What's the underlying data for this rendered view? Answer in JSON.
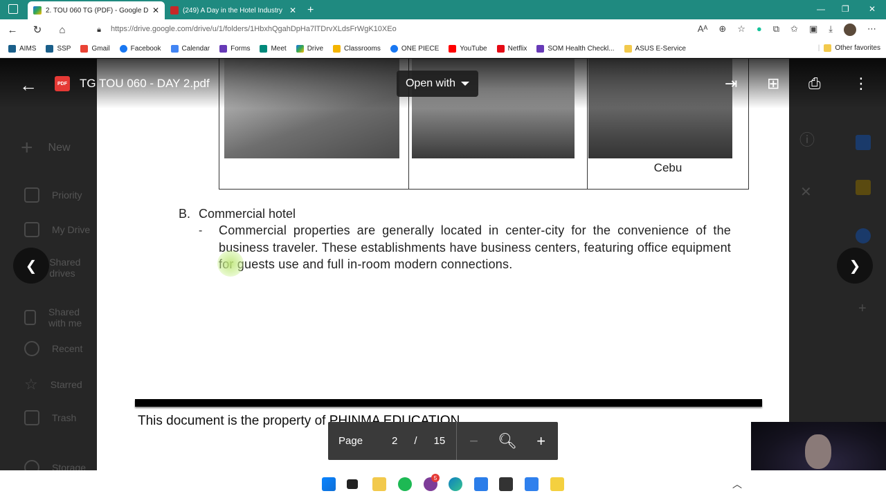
{
  "browser": {
    "tabs": [
      {
        "title": "2. TOU 060 TG (PDF) - Google Dr",
        "active": true
      },
      {
        "title": "(249) A Day in the Hotel Industry",
        "active": false
      }
    ],
    "url": "https://drive.google.com/drive/u/1/folders/1HbxhQgahDpHa7lTDrvXLdsFrWgK10XEo",
    "bookmarks": [
      "AIMS",
      "SSP",
      "Gmail",
      "Facebook",
      "Calendar",
      "Forms",
      "Meet",
      "Drive",
      "Classrooms",
      "ONE PIECE",
      "YouTube",
      "Netflix",
      "SOM Health Checkl...",
      "ASUS E-Service"
    ],
    "other_favorites": "Other favorites"
  },
  "drive": {
    "new_label": "New",
    "sidebar": [
      "Priority",
      "My Drive",
      "Shared drives",
      "Shared with me",
      "Recent",
      "Starred",
      "Trash",
      "Storage"
    ]
  },
  "viewer": {
    "file_title": "TG TOU 060 - DAY 2.pdf",
    "pdf_badge": "PDF",
    "open_with": "Open with",
    "page_label": "Page",
    "current_page": "2",
    "page_sep": "/",
    "total_pages": "15"
  },
  "document": {
    "photo_captions": [
      "",
      "",
      "Cebu"
    ],
    "section_letter": "B.",
    "section_title": "Commercial hotel",
    "bullet": "-",
    "paragraph": "Commercial properties are generally located in center-city for the convenience of the business traveler. These establishments have business centers, featuring office equipment for guests use and full in-room modern connections.",
    "footer_prefix": "This document is the property of ",
    "footer_org": "PHINMA EDUCATION"
  },
  "taskbar": {
    "notification_count": "5"
  }
}
